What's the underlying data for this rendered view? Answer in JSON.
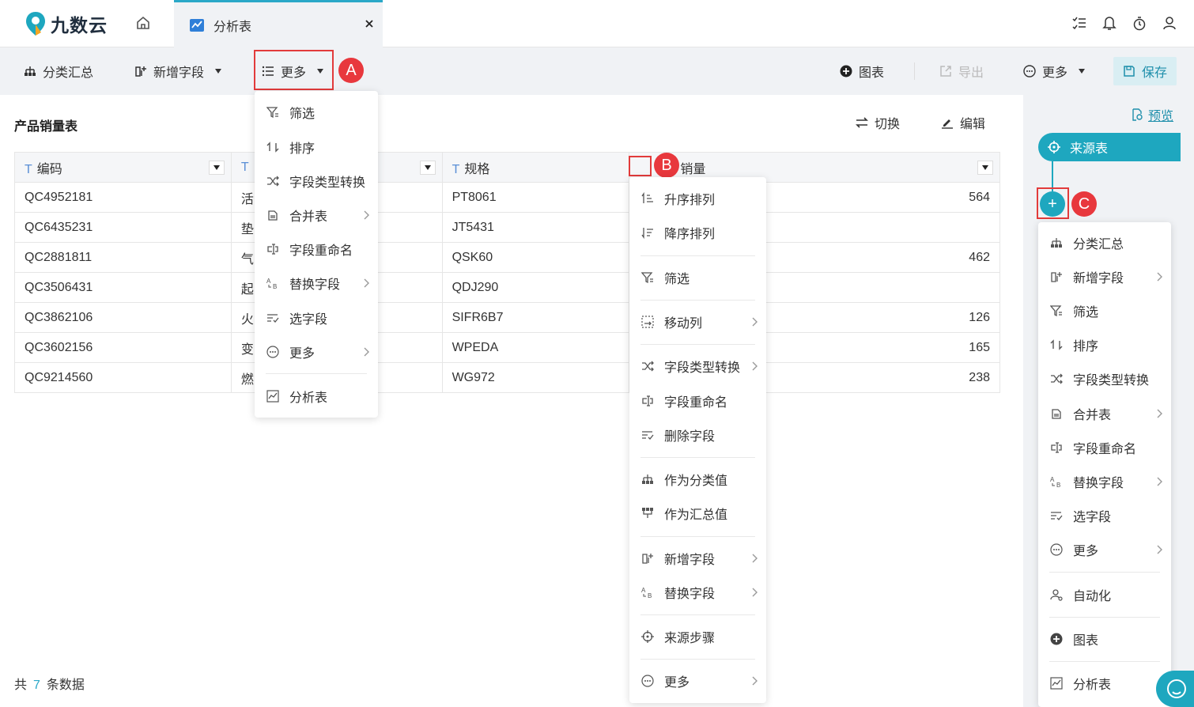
{
  "app": {
    "logo_text": "九数云",
    "tab_label": "分析表"
  },
  "toolbar": {
    "group_summary": "分类汇总",
    "add_field": "新增字段",
    "more": "更多",
    "badge_a": "A",
    "chart": "图表",
    "export": "导出",
    "more_right": "更多",
    "save": "保存"
  },
  "main": {
    "title": "产品销量表",
    "switch": "切换",
    "edit": "编辑",
    "columns": [
      "编码",
      "",
      "规格",
      "销量"
    ],
    "column_type_marker": "T",
    "rows": [
      {
        "code": "QC4952181",
        "name": "活",
        "spec": "PT8061",
        "sales": "564"
      },
      {
        "code": "QC6435231",
        "name": "垫",
        "spec": "JT5431",
        "sales": ""
      },
      {
        "code": "QC2881811",
        "name": "气",
        "spec": "QSK60",
        "sales": "462"
      },
      {
        "code": "QC3506431",
        "name": "起",
        "spec": "QDJ290",
        "sales": ""
      },
      {
        "code": "QC3862106",
        "name": "火",
        "spec": "SIFR6B7",
        "sales": "126"
      },
      {
        "code": "QC3602156",
        "name": "变",
        "spec": "WPEDA",
        "sales": "165"
      },
      {
        "code": "QC9214560",
        "name": "燃",
        "spec": "WG972",
        "sales": "238"
      }
    ],
    "footer": {
      "prefix": "共",
      "count": "7",
      "suffix": "条数据"
    },
    "badge_b": "B"
  },
  "menu_a": {
    "items": [
      "筛选",
      "排序",
      "字段类型转换",
      "合并表",
      "字段重命名",
      "替换字段",
      "选字段",
      "更多",
      "分析表"
    ]
  },
  "menu_b": {
    "items": [
      "升序排列",
      "降序排列",
      "筛选",
      "移动列",
      "字段类型转换",
      "字段重命名",
      "删除字段",
      "作为分类值",
      "作为汇总值",
      "新增字段",
      "替换字段",
      "来源步骤",
      "更多"
    ]
  },
  "right_panel": {
    "preview": "预览",
    "source": "来源表",
    "badge_c": "C",
    "plus": "+",
    "menu": [
      "分类汇总",
      "新增字段",
      "筛选",
      "排序",
      "字段类型转换",
      "合并表",
      "字段重命名",
      "替换字段",
      "选字段",
      "更多",
      "自动化",
      "图表",
      "分析表"
    ]
  },
  "colors": {
    "accent": "#1ea7bf",
    "highlight": "#e23b3b",
    "save_bg": "#d9eef3"
  }
}
